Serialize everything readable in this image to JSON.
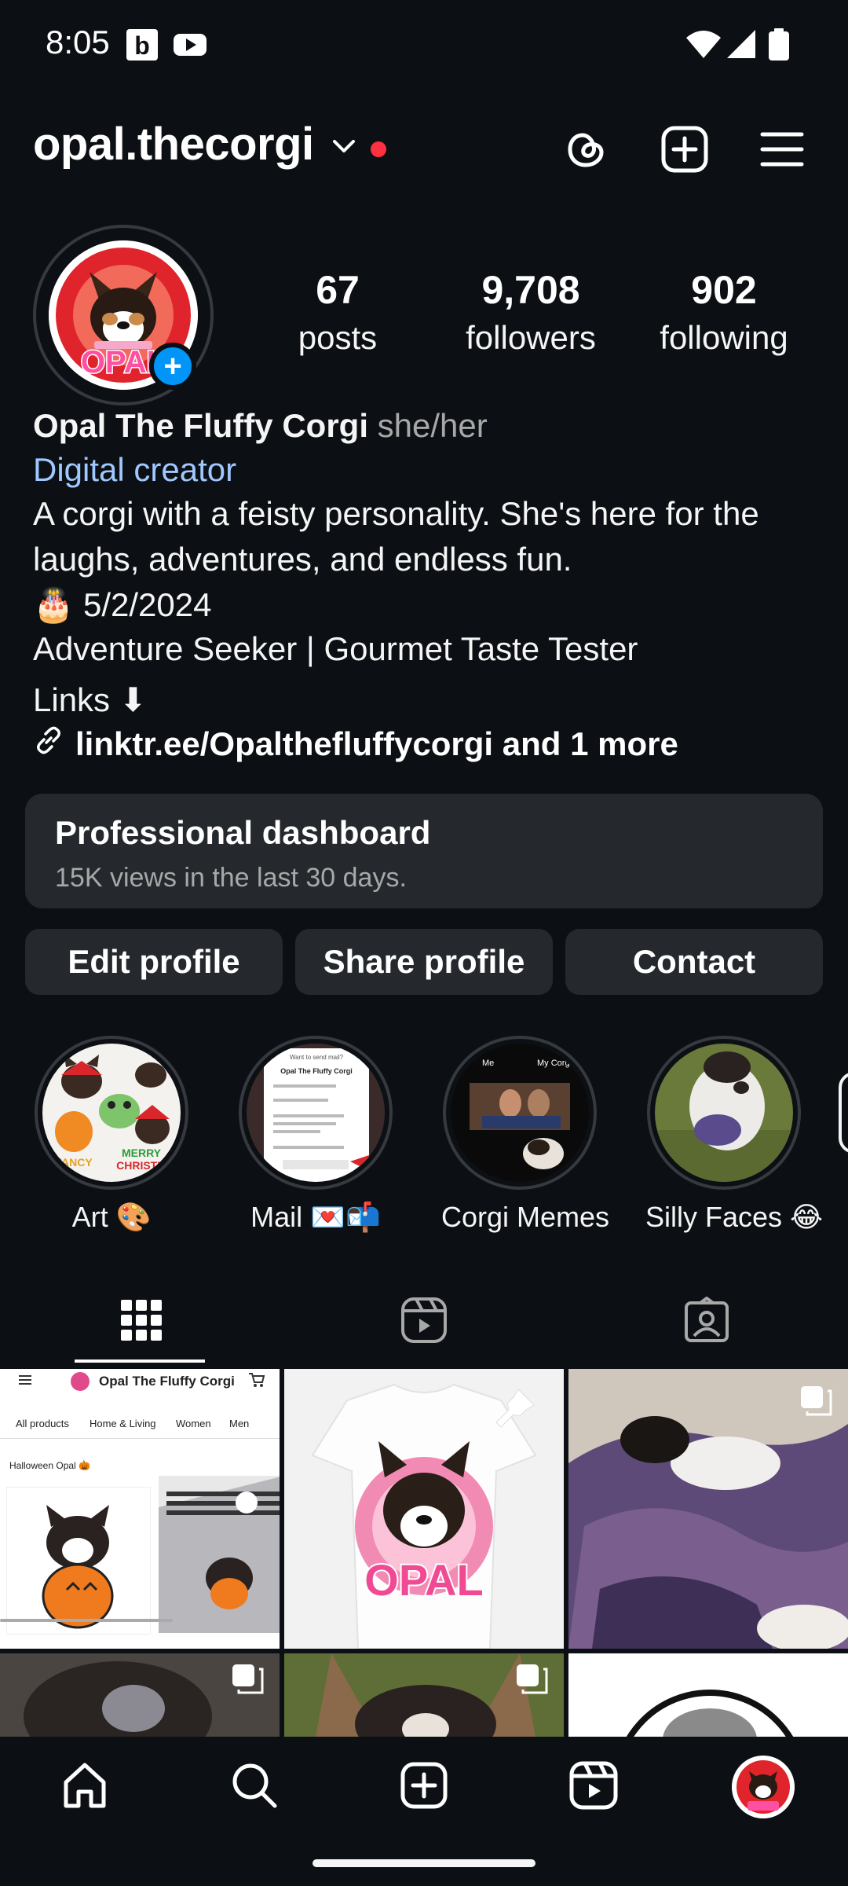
{
  "status_bar": {
    "time": "8:05"
  },
  "header": {
    "username": "opal.thecorgi"
  },
  "profile": {
    "avatar_text": "OPAL",
    "stats": [
      {
        "value": "67",
        "label": "posts"
      },
      {
        "value": "9,708",
        "label": "followers"
      },
      {
        "value": "902",
        "label": "following"
      }
    ],
    "display_name": "Opal The Fluffy Corgi",
    "pronouns": "she/her",
    "category": "Digital creator",
    "bio_line1": "A corgi with a feisty personality. She's here for the",
    "bio_line2": "laughs, adventures, and endless fun.",
    "birthday_emoji": "🎂",
    "birthday": "5/2/2024",
    "tagline": "Adventure Seeker | Gourmet Taste Tester",
    "links_label": "Links ⬇",
    "link": "linktr.ee/Opalthefluffycorgi and 1 more"
  },
  "dashboard": {
    "title": "Professional dashboard",
    "subtitle": "15K views in the last 30 days."
  },
  "buttons": {
    "edit": "Edit profile",
    "share": "Share profile",
    "contact": "Contact"
  },
  "highlights": [
    {
      "label": "Art 🎨"
    },
    {
      "label": "Mail 💌📬"
    },
    {
      "label": "Corgi Memes"
    },
    {
      "label": "Silly Faces 😂"
    }
  ],
  "highlight_art": {
    "line1": "FANCY",
    "line2": "MERRY",
    "line3": "CHRISTM"
  },
  "highlight_mail": {
    "title": "Opal The Fluffy Corgi",
    "heading": "Want to send mail?"
  },
  "highlight_memes": {
    "me": "Me",
    "my_corgi": "My Corgi"
  },
  "grid": {
    "shop": {
      "title": "Opal The Fluffy Corgi",
      "nav": [
        "All products",
        "Home & Living",
        "Women",
        "Men"
      ],
      "section": "Halloween Opal 🎃"
    },
    "shirt_text": "OPAL"
  },
  "colors": {
    "background": "#0c1014",
    "surface": "#25292e",
    "accent_blue": "#0095f6",
    "link_blue": "#a0c8ff",
    "notif_red": "#ff3040"
  }
}
